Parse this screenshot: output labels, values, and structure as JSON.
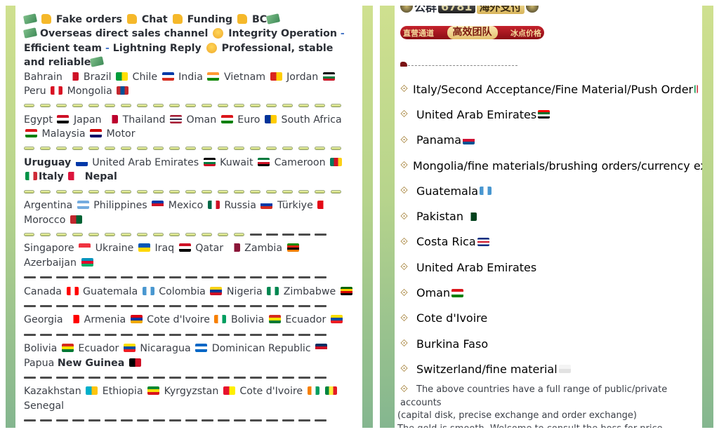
{
  "left_panel": {
    "header_lines": [
      {
        "segments": [
          {
            "icon": "money-wings-icon"
          },
          {
            "icon": "thumbs-up-icon"
          },
          {
            "text": " Fake orders "
          },
          {
            "icon": "thumbs-up-icon"
          },
          {
            "text": " Chat "
          },
          {
            "icon": "thumbs-up-icon"
          },
          {
            "text": " Funding "
          },
          {
            "icon": "thumbs-up-icon"
          },
          {
            "text": " BC"
          },
          {
            "icon": "money-wings-icon"
          }
        ]
      }
    ],
    "line1": {
      "a": "Fake orders",
      "b": "Chat",
      "c": "Funding",
      "d": "BC"
    },
    "line2": {
      "a": "Overseas direct sales channel",
      "b": "Integrity Operation",
      "dash": "-",
      "c": "Efficient team",
      "d": "Lightning Reply",
      "e": "Professional, stable and reliable"
    },
    "groups": [
      {
        "countries": [
          {
            "name": "Bahrain",
            "flag": "bahrain-flag"
          },
          {
            "name": "Brazil",
            "flag": "brazil-flag"
          },
          {
            "name": "Chile",
            "flag": "chile-flag"
          },
          {
            "name": "India",
            "flag": "india-flag"
          },
          {
            "name": "Vietnam",
            "flag": "vietnam-flag"
          },
          {
            "name": "Jordan",
            "flag": "jordan-flag"
          },
          {
            "name": "Peru",
            "flag": "peru-flag"
          },
          {
            "name": "Mongolia",
            "flag": "mongolia-flag"
          }
        ],
        "separator": {
          "pills": 20,
          "dashes": 0
        }
      },
      {
        "countries": [
          {
            "name": "Egypt",
            "flag": "egypt-flag"
          },
          {
            "name": "Japan",
            "flag": "japan-flag"
          },
          {
            "name": "Thailand",
            "flag": "thailand-flag"
          },
          {
            "name": "Oman",
            "flag": "oman-flag"
          },
          {
            "name": "Euro",
            "flag": "eu-flag"
          },
          {
            "name": "South Africa",
            "flag": "oman-flag"
          },
          {
            "name": "Malaysia",
            "flag": "malaysia-flag"
          },
          {
            "name": "Motor",
            "flag": ""
          }
        ],
        "separator": {
          "pills": 20,
          "dashes": 0
        }
      },
      {
        "countries": [
          {
            "name": "Uruguay",
            "flag": "uruguay-flag",
            "bold": true
          },
          {
            "name": "United Arab Emirates",
            "flag": "jordan-flag"
          },
          {
            "name": "Kuwait",
            "flag": "kuwait-flag"
          },
          {
            "name": "Cameroon",
            "flag": "cameroon-flag"
          },
          {
            "name": "Italy",
            "flag": "nepal-flag",
            "bold": true,
            "prefix_flag": "italy-flag"
          },
          {
            "name": "Nepal",
            "flag": "",
            "bold": true
          }
        ],
        "separator": {
          "pills": 20,
          "dashes": 0
        }
      },
      {
        "countries": [
          {
            "name": "Argentina",
            "flag": "argentina-flag"
          },
          {
            "name": "Philippines",
            "flag": "philippines-flag"
          },
          {
            "name": "Mexico",
            "flag": "mexico-flag"
          },
          {
            "name": "Russia",
            "flag": "russia-flag"
          },
          {
            "name": "Türkiye",
            "flag": "turkey-flag"
          },
          {
            "name": "Morocco",
            "flag": "morocco-flag"
          }
        ],
        "separator": {
          "pills": 14,
          "dashes": 5
        }
      },
      {
        "countries": [
          {
            "name": "Singapore",
            "flag": "singapore-flag"
          },
          {
            "name": "Ukraine",
            "flag": "ukraine-flag"
          },
          {
            "name": "Iraq",
            "flag": "iraq-flag"
          },
          {
            "name": "Qatar",
            "flag": "qatar-flag"
          },
          {
            "name": "Zambia",
            "flag": "zambia-flag"
          },
          {
            "name": "Azerbaijan",
            "flag": "azerbaijan-flag"
          }
        ],
        "separator": {
          "pills": 0,
          "dashes": 19
        }
      },
      {
        "countries": [
          {
            "name": "Canada",
            "flag": "canada-flag"
          },
          {
            "name": "Guatemala",
            "flag": "guatemala-flag"
          },
          {
            "name": "Colombia",
            "flag": "colombia-flag"
          },
          {
            "name": "Nigeria",
            "flag": "nigeria-flag"
          },
          {
            "name": "Zimbabwe",
            "flag": "zimbabwe-flag"
          }
        ],
        "separator": {
          "pills": 0,
          "dashes": 19
        }
      },
      {
        "countries": [
          {
            "name": "Georgia",
            "flag": "georgia-flag"
          },
          {
            "name": "Armenia",
            "flag": "armenia-flag"
          },
          {
            "name": "Cote d'Ivoire",
            "flag": "ivory-coast-flag"
          },
          {
            "name": "Bolivia",
            "flag": "bolivia-flag"
          },
          {
            "name": "Ecuador",
            "flag": "ecuador-flag"
          }
        ],
        "separator": {
          "pills": 0,
          "dashes": 19
        }
      },
      {
        "countries": [
          {
            "name": "Bolivia",
            "flag": "bolivia-flag"
          },
          {
            "name": "Ecuador",
            "flag": "ecuador-flag"
          },
          {
            "name": "Nicaragua",
            "flag": "nicaragua-flag"
          },
          {
            "name": "Dominican Republic",
            "flag": "dominican-flag"
          },
          {
            "name": "Papua New Guinea",
            "flag": "png-flag",
            "bold_tail": "New Guinea"
          }
        ],
        "separator": {
          "pills": 0,
          "dashes": 19
        }
      },
      {
        "countries": [
          {
            "name": "Kazakhstan",
            "flag": "kazakhstan-flag"
          },
          {
            "name": "Ethiopia",
            "flag": "ethiopia-flag"
          },
          {
            "name": "Kyrgyzstan",
            "flag": "kyrgyzstan-flag"
          },
          {
            "name": "Cote d'Ivoire",
            "flag": "ivory-coast-flag"
          },
          {
            "name": "Senegal",
            "flag": "senegal-flag",
            "flag_before": true
          }
        ],
        "separator": {
          "pills": 0,
          "dashes": 19
        }
      }
    ]
  },
  "right_panel": {
    "banner_top": {
      "left": "公群",
      "number": "6781",
      "right": "海外支付"
    },
    "banner_bottom": {
      "left": "直营通道",
      "middle": "高效团队",
      "right": "冰点价格"
    },
    "items": [
      {
        "text": "Italy/Second Acceptance/Fine Material/Push Order",
        "flag": "italy-flag"
      },
      {
        "text": "United Arab Emirates",
        "flag": "uae-flag"
      },
      {
        "text": "Panama",
        "flag": "panama-flag"
      },
      {
        "text": "Mongolia/fine materials/brushing orders/currency exchange",
        "flag": "mongolia-flag"
      },
      {
        "text": "Guatemala",
        "flag": "guatemala-flag"
      },
      {
        "text": "Pakistan",
        "flag": "pakistan-flag"
      },
      {
        "text": "Costa Rica ",
        "flag": "costa-rica-flag"
      },
      {
        "text": "United Arab Emirates",
        "flag": ""
      },
      {
        "text": "Oman ",
        "flag": "oman-flag"
      },
      {
        "text": "Cote d'Ivoire",
        "flag": ""
      },
      {
        "text": "Burkina Faso",
        "flag": ""
      },
      {
        "text": "Switzerland/fine material",
        "flag": "blank-flag"
      }
    ],
    "final_line1": "The above countries have a full range of public/private accounts",
    "final_line2": "(capital disk, precise exchange and order exchange)",
    "final_line3": "The gold is smooth. Welcome to consult the boss for price"
  },
  "flag_colors": {
    "bahrain-flag": [
      "#ffffff",
      "#ce1126"
    ],
    "brazil-flag": [
      "#009c3b",
      "#ffdf00"
    ],
    "chile-flag": [
      "#0039a6",
      "#ffffff",
      "#d52b1e"
    ],
    "india-flag": [
      "#ff9933",
      "#ffffff",
      "#138808"
    ],
    "vietnam-flag": [
      "#da251d",
      "#ffcd00"
    ],
    "jordan-flag": [
      "#000000",
      "#ffffff",
      "#007a3d",
      "#ce1126"
    ],
    "peru-flag": [
      "#d91023",
      "#ffffff",
      "#d91023"
    ],
    "mongolia-flag": [
      "#c4272f",
      "#015197",
      "#c4272f"
    ],
    "egypt-flag": [
      "#ce1126",
      "#ffffff",
      "#000000"
    ],
    "japan-flag": [
      "#ffffff",
      "#bc002d"
    ],
    "thailand-flag": [
      "#a51931",
      "#f4f5f8",
      "#2d2a4a",
      "#f4f5f8",
      "#a51931"
    ],
    "oman-flag": [
      "#db161b",
      "#ffffff",
      "#008000"
    ],
    "eu-flag": [
      "#003399",
      "#ffcc00"
    ],
    "malaysia-flag": [
      "#cc0001",
      "#ffffff",
      "#010066"
    ],
    "uruguay-flag": [
      "#ffffff",
      "#0038a8"
    ],
    "kuwait-flag": [
      "#007a3d",
      "#ffffff",
      "#ce1126",
      "#000000"
    ],
    "cameroon-flag": [
      "#007a5e",
      "#ce1126",
      "#fcd116"
    ],
    "italy-flag": [
      "#009246",
      "#ffffff",
      "#ce2b37"
    ],
    "nepal-flag": [
      "#dc143c",
      "#ffffff"
    ],
    "argentina-flag": [
      "#74acdf",
      "#ffffff",
      "#74acdf"
    ],
    "philippines-flag": [
      "#0038a8",
      "#ce1126",
      "#ffffff"
    ],
    "mexico-flag": [
      "#006847",
      "#ffffff",
      "#ce1126"
    ],
    "russia-flag": [
      "#ffffff",
      "#0039a6",
      "#d52b1e"
    ],
    "turkey-flag": [
      "#e30a17",
      "#ffffff"
    ],
    "morocco-flag": [
      "#c1272d",
      "#006233"
    ],
    "singapore-flag": [
      "#ef3340",
      "#ffffff"
    ],
    "ukraine-flag": [
      "#0057b7",
      "#ffd700"
    ],
    "iraq-flag": [
      "#ce1126",
      "#ffffff",
      "#000000"
    ],
    "qatar-flag": [
      "#ffffff",
      "#8a1538"
    ],
    "zambia-flag": [
      "#198a00",
      "#de2010",
      "#000000",
      "#ef7d00"
    ],
    "azerbaijan-flag": [
      "#0092bc",
      "#e4002b",
      "#00af66"
    ],
    "canada-flag": [
      "#ff0000",
      "#ffffff",
      "#ff0000"
    ],
    "guatemala-flag": [
      "#4997d0",
      "#ffffff",
      "#4997d0"
    ],
    "colombia-flag": [
      "#fcd116",
      "#003893",
      "#ce1126"
    ],
    "nigeria-flag": [
      "#008751",
      "#ffffff",
      "#008751"
    ],
    "zimbabwe-flag": [
      "#006400",
      "#ffd200",
      "#d40000",
      "#000000"
    ],
    "georgia-flag": [
      "#ffffff",
      "#ff0000"
    ],
    "armenia-flag": [
      "#d90012",
      "#0033a0",
      "#f2a800"
    ],
    "ivory-coast-flag": [
      "#f77f00",
      "#ffffff",
      "#009e60"
    ],
    "bolivia-flag": [
      "#d52b1e",
      "#f9e300",
      "#007934"
    ],
    "ecuador-flag": [
      "#ffdd00",
      "#034ea2",
      "#ed1c24"
    ],
    "nicaragua-flag": [
      "#0067c6",
      "#ffffff",
      "#0067c6"
    ],
    "dominican-flag": [
      "#002d62",
      "#ce1126",
      "#ffffff"
    ],
    "png-flag": [
      "#000000",
      "#ce1126"
    ],
    "kazakhstan-flag": [
      "#00afca",
      "#fec50c"
    ],
    "ethiopia-flag": [
      "#078930",
      "#fcdd09",
      "#da121a"
    ],
    "kyrgyzstan-flag": [
      "#e8112d",
      "#ffef00"
    ],
    "senegal-flag": [
      "#00853f",
      "#fdef42",
      "#e31b23"
    ],
    "uae-flag": [
      "#ff0000",
      "#00732f",
      "#ffffff",
      "#000000"
    ],
    "panama-flag": [
      "#ffffff",
      "#d21034",
      "#005293"
    ],
    "pakistan-flag": [
      "#ffffff",
      "#01411c"
    ],
    "costa-rica-flag": [
      "#002b7f",
      "#ffffff",
      "#ce1126",
      "#ffffff",
      "#002b7f"
    ],
    "blank-flag": [
      "#f4f4f4",
      "#e2e2e2"
    ]
  },
  "accent_colors": {
    "strip_top": "#cfe08f",
    "strip_bottom": "#84b68f",
    "bullet": "#a07a2e",
    "dash_blue": "#4a78c8"
  }
}
